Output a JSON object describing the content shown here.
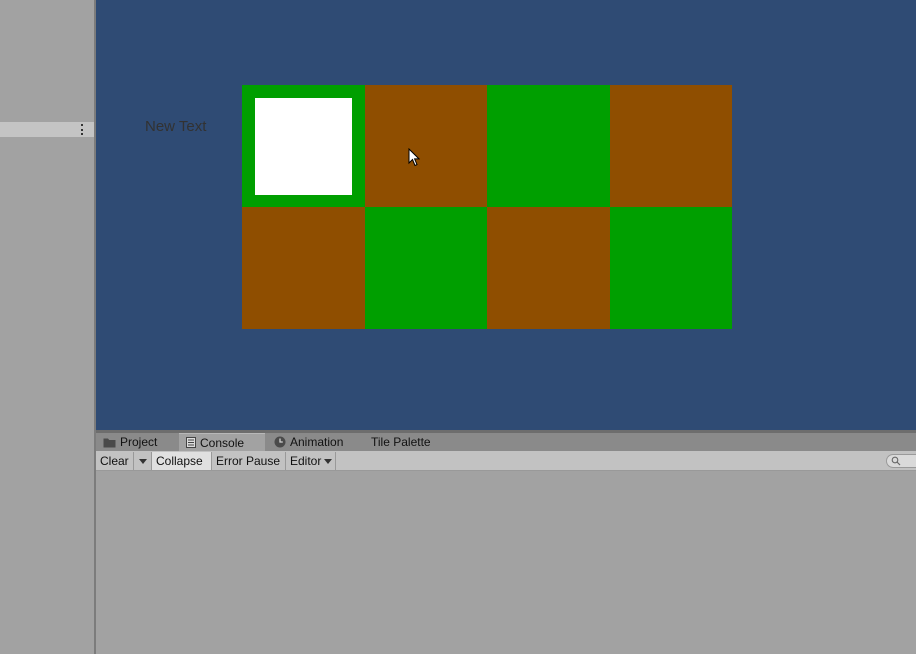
{
  "scene": {
    "label": "New Text",
    "tiles": [
      {
        "color": "green",
        "highlighted": true
      },
      {
        "color": "brown",
        "highlighted": false
      },
      {
        "color": "green",
        "highlighted": false
      },
      {
        "color": "brown",
        "highlighted": false
      },
      {
        "color": "brown",
        "highlighted": false
      },
      {
        "color": "green",
        "highlighted": false
      },
      {
        "color": "brown",
        "highlighted": false
      },
      {
        "color": "green",
        "highlighted": false
      }
    ],
    "colors": {
      "background": "#2f4b74",
      "green": "#009f00",
      "brown": "#8f4e00",
      "highlight": "#ffffff"
    }
  },
  "panel_tabs": [
    {
      "label": "Project",
      "icon": "folder-icon"
    },
    {
      "label": "Console",
      "icon": "console-icon",
      "active": true
    },
    {
      "label": "Animation",
      "icon": "clock-icon"
    },
    {
      "label": "Tile Palette"
    }
  ],
  "console_toolbar": {
    "clear_label": "Clear",
    "collapse_label": "Collapse",
    "error_pause_label": "Error Pause",
    "editor_label": "Editor",
    "search_icon": "search-icon"
  }
}
